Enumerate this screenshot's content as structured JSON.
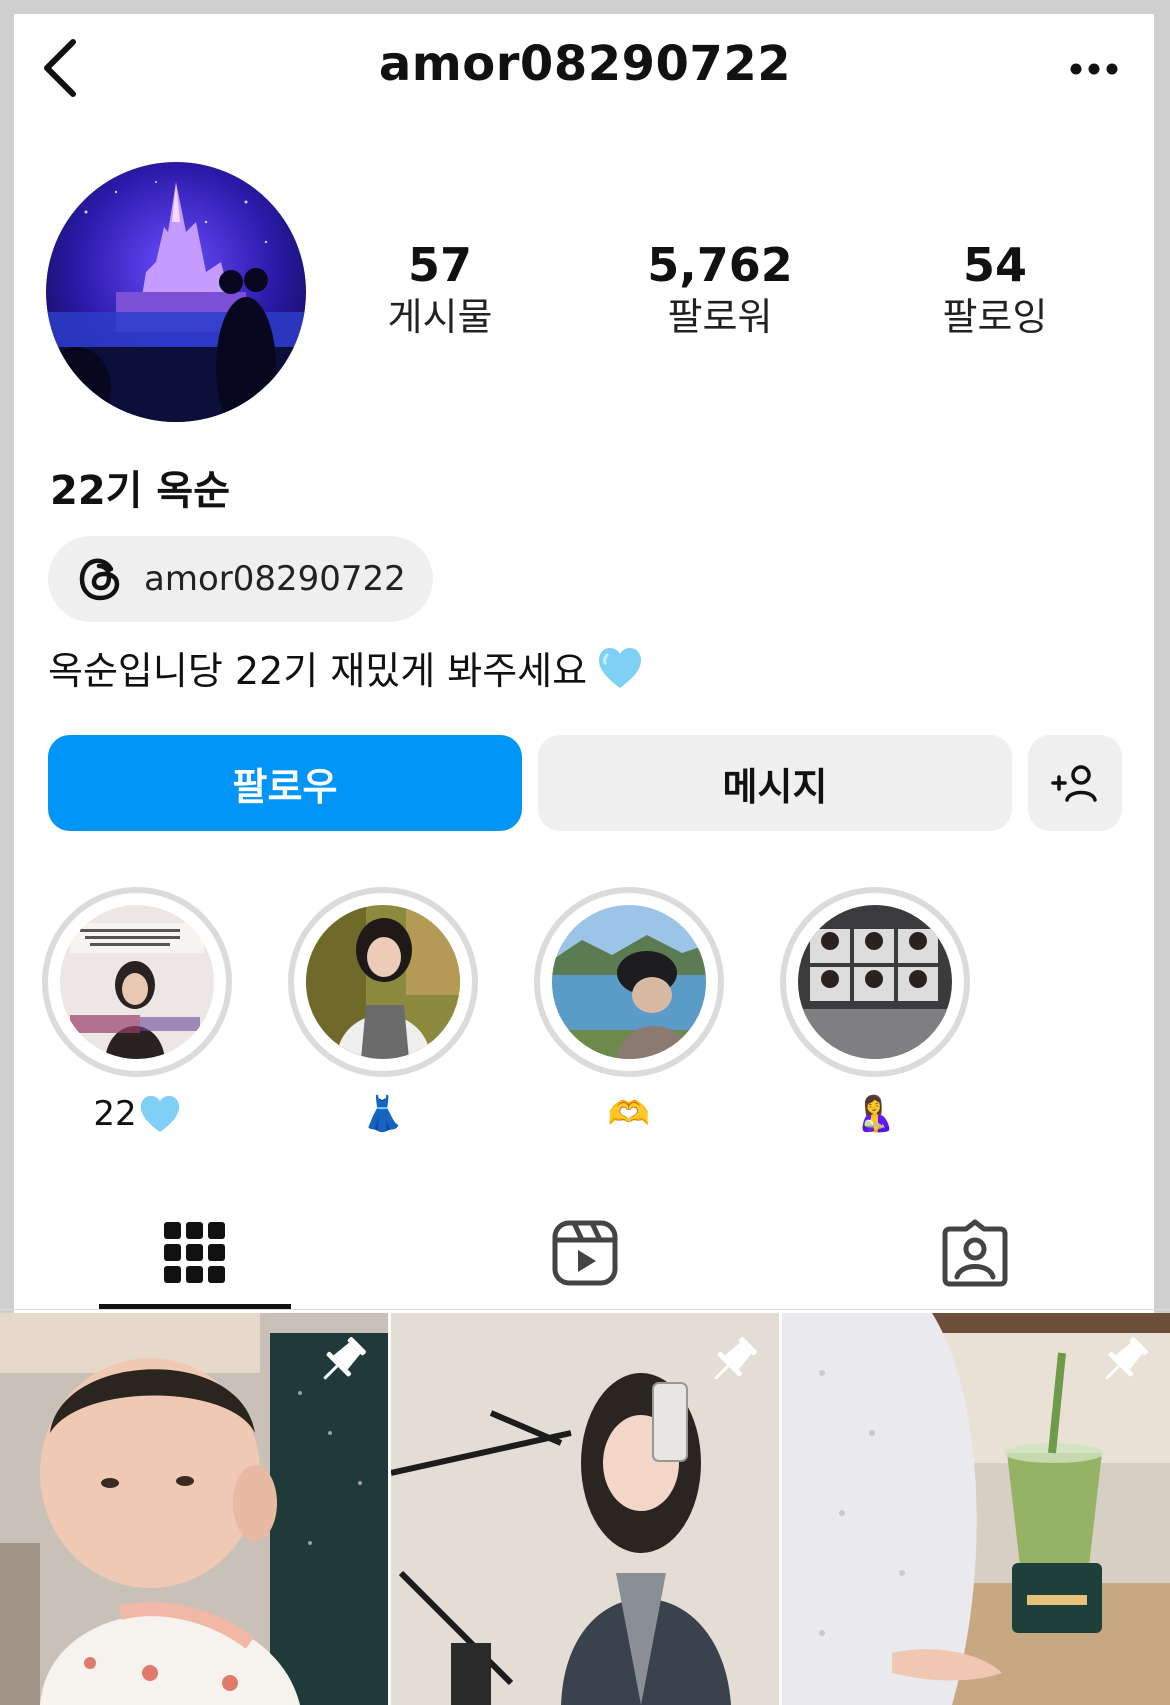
{
  "header": {
    "username": "amor08290722",
    "back_icon": "chevron-left-icon",
    "more_icon": "more-horizontal-icon"
  },
  "profile": {
    "stats": [
      {
        "value": "57",
        "label": "게시물"
      },
      {
        "value": "5,762",
        "label": "팔로워"
      },
      {
        "value": "54",
        "label": "팔로잉"
      }
    ],
    "display_name": "22기 옥순",
    "threads_handle": "amor08290722",
    "bio": "옥순입니당 22기 재밌게 봐주세요"
  },
  "actions": {
    "follow_label": "팔로우",
    "message_label": "메시지",
    "add_person_icon": "add-person-icon"
  },
  "highlights": [
    {
      "label": "22",
      "emoji": "light-blue-heart"
    },
    {
      "label": "👗"
    },
    {
      "label": "🫶"
    },
    {
      "label": "🤱"
    }
  ],
  "tabs": [
    {
      "icon": "grid-icon",
      "active": true
    },
    {
      "icon": "reels-icon",
      "active": false
    },
    {
      "icon": "tagged-icon",
      "active": false
    }
  ],
  "colors": {
    "accent": "#0095f6",
    "button_bg": "#efefef",
    "heart": "#7fd0f5"
  }
}
